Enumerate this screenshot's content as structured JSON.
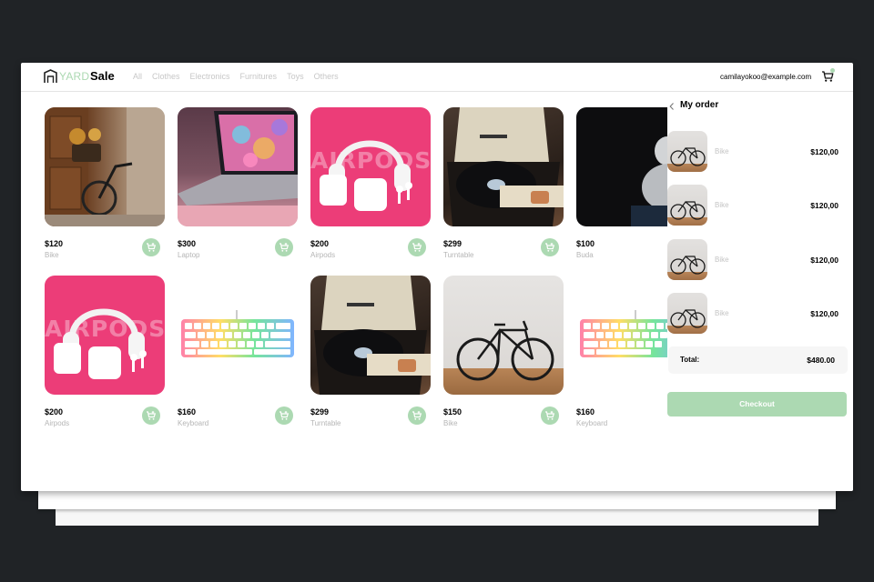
{
  "brand": {
    "part1": "YARD",
    "part2": "Sale",
    "icon": "house-logo-icon"
  },
  "nav": [
    "All",
    "Clothes",
    "Electronics",
    "Furnitures",
    "Toys",
    "Others"
  ],
  "user": {
    "email": "camilayokoo@example.com"
  },
  "cart_icon": "shopping-cart-icon",
  "products": [
    {
      "price": "$120",
      "name": "Bike",
      "image": "bike-photo"
    },
    {
      "price": "$300",
      "name": "Laptop",
      "image": "laptop-photo"
    },
    {
      "price": "$200",
      "name": "Airpods",
      "image": "airpods-photo",
      "overlay": "AIRPODS"
    },
    {
      "price": "$299",
      "name": "Turntable",
      "image": "turntable-photo"
    },
    {
      "price": "$100",
      "name": "Buda",
      "image": "buddha-statue-photo"
    },
    {
      "price": "$200",
      "name": "Airpods",
      "image": "airpods-photo",
      "overlay": "AIRPODS"
    },
    {
      "price": "$160",
      "name": "Keyboard",
      "image": "keyboard-photo"
    },
    {
      "price": "$299",
      "name": "Turntable",
      "image": "turntable-photo"
    },
    {
      "price": "$150",
      "name": "Bike",
      "image": "road-bike-photo"
    },
    {
      "price": "$160",
      "name": "Keyboard",
      "image": "keyboard-photo"
    }
  ],
  "order": {
    "title": "My order",
    "items": [
      {
        "name": "Bike",
        "price": "$120,00"
      },
      {
        "name": "Bike",
        "price": "$120,00"
      },
      {
        "name": "Bike",
        "price": "$120,00"
      },
      {
        "name": "Bike",
        "price": "$120,00"
      }
    ],
    "total_label": "Total:",
    "total_value": "$480.00",
    "checkout_label": "Checkout"
  },
  "colors": {
    "accent": "#ACD9B2",
    "muted_text": "#C7C7C7",
    "backdrop": "#202326"
  }
}
